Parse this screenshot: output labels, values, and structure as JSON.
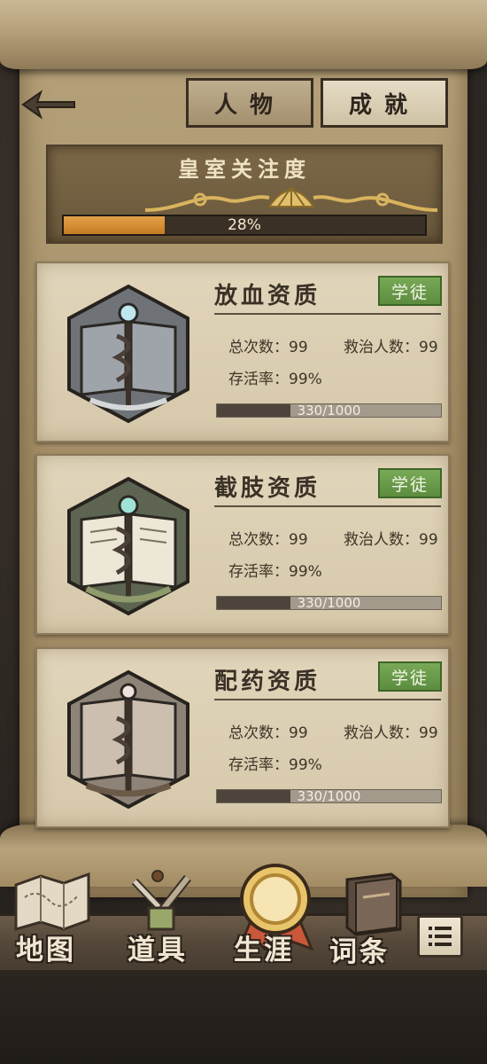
{
  "tabs": [
    {
      "label": "人物",
      "active": true
    },
    {
      "label": "成就",
      "active": false
    }
  ],
  "royal_attention": {
    "title": "皇室关注度",
    "percent": 28,
    "percent_label": "28%"
  },
  "skills": [
    {
      "name": "放血资质",
      "rank": "学徒",
      "total_label": "总次数：",
      "total_value": "99",
      "patients_label": "救治人数：",
      "patients_value": "99",
      "survival_label": "存活率：",
      "survival_value": "99%",
      "xp_current": 330,
      "xp_max": 1000,
      "xp_text": "330/1000",
      "emblem_icon": "blood-book-emblem-icon"
    },
    {
      "name": "截肢资质",
      "rank": "学徒",
      "total_label": "总次数：",
      "total_value": "99",
      "patients_label": "救治人数：",
      "patients_value": "99",
      "survival_label": "存活率：",
      "survival_value": "99%",
      "xp_current": 330,
      "xp_max": 1000,
      "xp_text": "330/1000",
      "emblem_icon": "amputation-book-emblem-icon"
    },
    {
      "name": "配药资质",
      "rank": "学徒",
      "total_label": "总次数：",
      "total_value": "99",
      "patients_label": "救治人数：",
      "patients_value": "99",
      "survival_label": "存活率：",
      "survival_value": "99%",
      "xp_current": 330,
      "xp_max": 1000,
      "xp_text": "330/1000",
      "emblem_icon": "pharmacy-book-emblem-icon"
    }
  ],
  "nav": [
    {
      "label": "地图",
      "icon": "map-icon"
    },
    {
      "label": "道具",
      "icon": "tools-icon"
    },
    {
      "label": "生涯",
      "icon": "medal-icon",
      "active": true
    },
    {
      "label": "词条",
      "icon": "book-icon"
    }
  ],
  "colors": {
    "accent_orange": "#d48f35",
    "rank_green": "#6a9b4a",
    "parchment": "#d6c8aa",
    "frame_brown": "#a38d66"
  }
}
